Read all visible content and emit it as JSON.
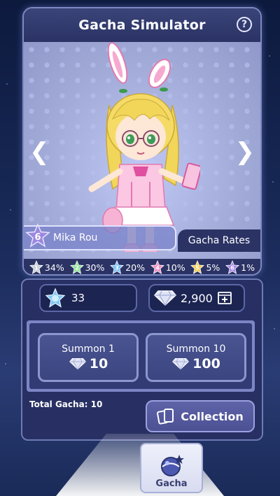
{
  "header": {
    "title": "Gacha Simulator",
    "help_label": "?"
  },
  "character": {
    "name": "Mika Rou",
    "rarity": "6"
  },
  "rates_tab": "Gacha Rates",
  "rates": [
    {
      "star": "1",
      "value": "34%",
      "color": "#c9d1dc"
    },
    {
      "star": "2",
      "value": "30%",
      "color": "#8fe39a"
    },
    {
      "star": "3",
      "value": "20%",
      "color": "#7cc3f2"
    },
    {
      "star": "4",
      "value": "10%",
      "color": "#f092c4"
    },
    {
      "star": "5",
      "value": "5%",
      "color": "#f4cf5a"
    },
    {
      "star": "6",
      "value": "1%",
      "color": "#a98be8"
    }
  ],
  "currency": {
    "gems": "33",
    "diamonds": "2,900"
  },
  "summon": [
    {
      "label": "Summon 1",
      "cost": "10"
    },
    {
      "label": "Summon 10",
      "cost": "100"
    }
  ],
  "total_gacha": "Total Gacha: 10",
  "collection_label": "Collection",
  "nav": {
    "gacha_label": "Gacha"
  }
}
